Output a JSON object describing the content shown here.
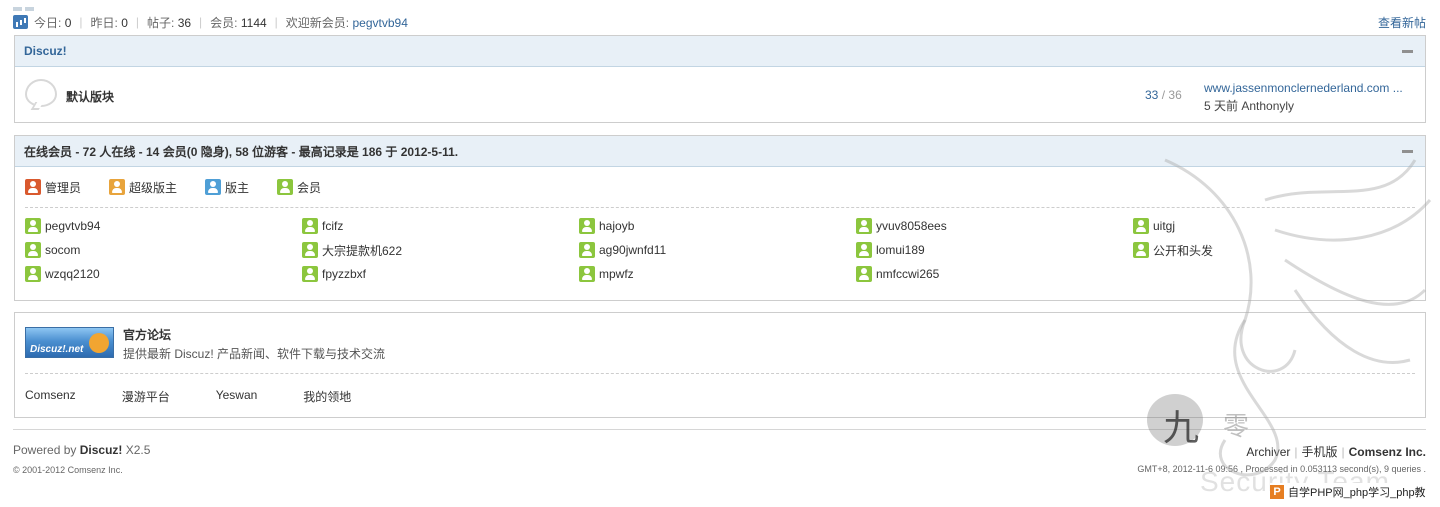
{
  "stats": {
    "today_label": "今日:",
    "today_value": "0",
    "yesterday_label": "昨日:",
    "yesterday_value": "0",
    "posts_label": "帖子:",
    "posts_value": "36",
    "members_label": "会员:",
    "members_value": "1144",
    "welcome_label": "欢迎新会员:",
    "newest_member": "pegvtvb94",
    "view_new": "查看新帖"
  },
  "category": {
    "title": "Discuz!",
    "forums": [
      {
        "name": "默认版块",
        "threads": "33",
        "separator": "/",
        "posts": "36",
        "last_post_title": "www.jassenmonclernederland.com ...",
        "last_post_by": "5 天前 Anthonyly"
      }
    ]
  },
  "online": {
    "title": "在线会员 - 72 人在线 - 14 会员(0 隐身), 58 位游客 - 最高记录是 186 于 2012-5-11.",
    "legend": {
      "admin": "管理员",
      "supermod": "超级版主",
      "mod": "版主",
      "member": "会员"
    },
    "members": [
      "pegvtvb94",
      "fcifz",
      "hajoyb",
      "yvuv8058ees",
      "uitgj",
      "socom",
      "大宗提款机622",
      "ag90jwnfd11",
      "lomui189",
      "公开和头发",
      "wzqq2120",
      "fpyzzbxf",
      "mpwfz",
      "nmfccwi265"
    ]
  },
  "links": {
    "logo_text": "Discuz!.net",
    "title": "官方论坛",
    "desc": "提供最新 Discuz! 产品新闻、软件下载与技术交流",
    "text_links": [
      "Comsenz",
      "漫游平台",
      "Yeswan",
      "我的领地"
    ]
  },
  "footer": {
    "powered_prefix": "Powered by",
    "powered_brand": "Discuz!",
    "powered_version": "X2.5",
    "copyright": "© 2001-2012 Comsenz Inc.",
    "archiver": "Archiver",
    "mobile": "手机版",
    "company": "Comsenz Inc.",
    "gmt": "GMT+8, 2012-11-6 09:56 , Processed in 0.053113 second(s), 9 queries ."
  },
  "watermark": {
    "text": "Security Team",
    "badge": "自学PHP网_php学习_php教"
  },
  "colors": {
    "link_blue": "#336699",
    "head_bg": "#e8f0f7",
    "border": "#cdcdcd"
  }
}
